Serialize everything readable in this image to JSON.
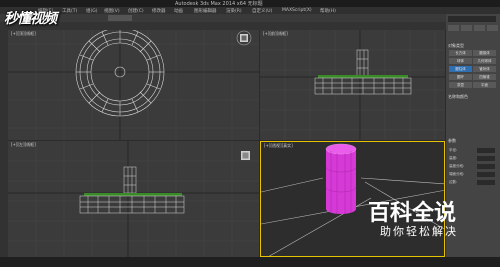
{
  "window": {
    "title": "Autodesk 3ds Max 2014 x64    无标题"
  },
  "menu": {
    "items": [
      "编辑(E)",
      "工具(T)",
      "组(G)",
      "视图(V)",
      "创建(C)",
      "修改器",
      "动画",
      "图形编辑器",
      "渲染(R)",
      "自定义(U)",
      "MAXScript(X)",
      "帮助(H)"
    ]
  },
  "viewports": {
    "top": "[+][顶][线框]",
    "front": "[+][前][线框]",
    "left": "[+][左][线框]",
    "perspective": "[+][透视][真实]"
  },
  "panel": {
    "section1": "对象类型",
    "buttons": [
      "长方体",
      "圆锥体",
      "球体",
      "几何球体",
      "圆柱体",
      "管状体",
      "圆环",
      "四棱锥",
      "茶壶",
      "平面"
    ],
    "active_button": "圆柱体",
    "section2": "名称和颜色",
    "section3": "参数",
    "params": [
      "半径:",
      "高度:",
      "高度分段:",
      "端面分段:",
      "边数:"
    ]
  },
  "watermarks": {
    "top_left": "秒懂视频",
    "brand_title": "百科全说",
    "brand_sub": "助你轻松解决"
  },
  "colors": {
    "accent": "#2f6fb1",
    "cylinder": "#e040e0",
    "grass": "#3a8a2a"
  }
}
